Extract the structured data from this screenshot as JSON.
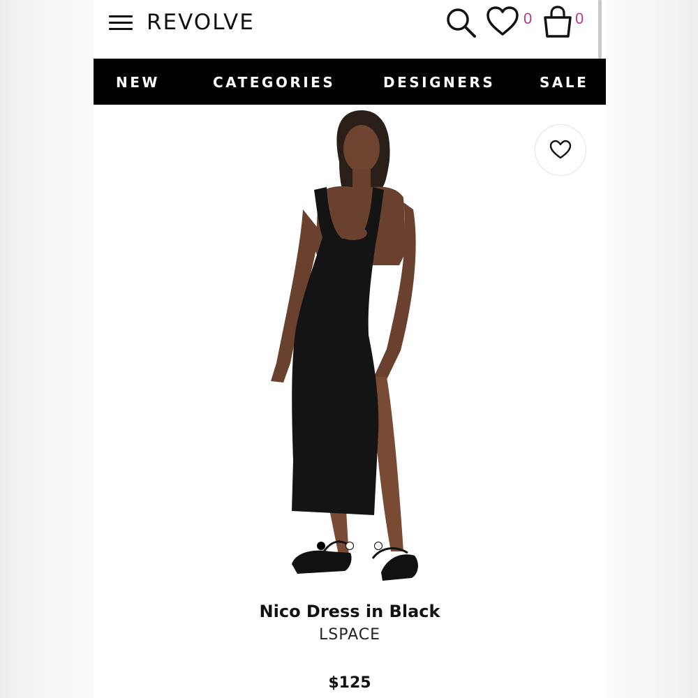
{
  "header": {
    "logo": "REVOLVE",
    "wishlist_count": "0",
    "bag_count": "0",
    "icons": [
      "menu-icon",
      "search-icon",
      "heart-icon",
      "bag-icon"
    ]
  },
  "nav": {
    "items": [
      "NEW",
      "CATEGORIES",
      "DESIGNERS",
      "SALE"
    ]
  },
  "product": {
    "image": "product-photo",
    "carousel": {
      "total": 3,
      "active": 1
    },
    "name": "Nico Dress in Black",
    "brand": "LSPACE",
    "price": "$125"
  },
  "colors": {
    "nav_background": "#000000",
    "badge_count": "#b03a8a",
    "text": "#111111"
  }
}
